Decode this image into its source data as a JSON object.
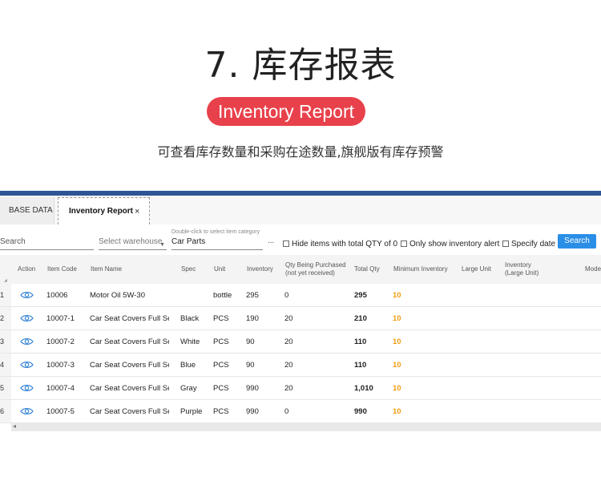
{
  "hero": {
    "title": "7. 库存报表",
    "badge": "Inventory Report",
    "subtitle": "可查看库存数量和采购在途数量,旗舰版有库存预警"
  },
  "colors": {
    "badge": "#e8414b",
    "bar": "#2f5597",
    "search_button": "#2a8ee6",
    "min_inventory": "#f39c12"
  },
  "tabs": [
    {
      "label": "BASE DATA"
    },
    {
      "label": "Inventory Report",
      "close": "×"
    }
  ],
  "filters": {
    "search_placeholder": "Search",
    "warehouse_placeholder": "Select warehouse",
    "warehouse_arrow": "▼",
    "category_hint": "Double-click to select item category",
    "category_value": "Car Parts",
    "more": "...",
    "hide_zero": "Hide items with total QTY of 0",
    "alert_only": "Only show inventory alert",
    "specify_date": "Specify date",
    "search_button": "Search"
  },
  "table": {
    "headers": {
      "action": "Action",
      "item_code": "Item Code",
      "item_name": "Item Name",
      "spec": "Spec",
      "unit": "Unit",
      "inventory": "Inventory",
      "qty_purchasing": "Qty Being Purchased",
      "qty_purchasing_note": "(not yet received)",
      "total_qty": "Total Qty",
      "min_inventory": "Minimum Inventory",
      "large_unit": "Large Unit",
      "inventory_large": "Inventory",
      "inventory_large_note": "(Large Unit)",
      "model": "Mode"
    },
    "rows": [
      {
        "n": "1",
        "code": "10006",
        "name": "Motor Oil 5W-30",
        "spec": "",
        "unit": "bottle",
        "inventory": "295",
        "purchasing": "0",
        "total": "295",
        "min": "10"
      },
      {
        "n": "2",
        "code": "10007-1",
        "name": "Car Seat Covers Full Set",
        "spec": "Black",
        "unit": "PCS",
        "inventory": "190",
        "purchasing": "20",
        "total": "210",
        "min": "10"
      },
      {
        "n": "3",
        "code": "10007-2",
        "name": "Car Seat Covers Full Set",
        "spec": "White",
        "unit": "PCS",
        "inventory": "90",
        "purchasing": "20",
        "total": "110",
        "min": "10"
      },
      {
        "n": "4",
        "code": "10007-3",
        "name": "Car Seat Covers Full Set",
        "spec": "Blue",
        "unit": "PCS",
        "inventory": "90",
        "purchasing": "20",
        "total": "110",
        "min": "10"
      },
      {
        "n": "5",
        "code": "10007-4",
        "name": "Car Seat Covers Full Set",
        "spec": "Gray",
        "unit": "PCS",
        "inventory": "990",
        "purchasing": "20",
        "total": "1,010",
        "min": "10"
      },
      {
        "n": "6",
        "code": "10007-5",
        "name": "Car Seat Covers Full Set",
        "spec": "Purple",
        "unit": "PCS",
        "inventory": "990",
        "purchasing": "0",
        "total": "990",
        "min": "10"
      }
    ],
    "scroll_left": "◂"
  }
}
